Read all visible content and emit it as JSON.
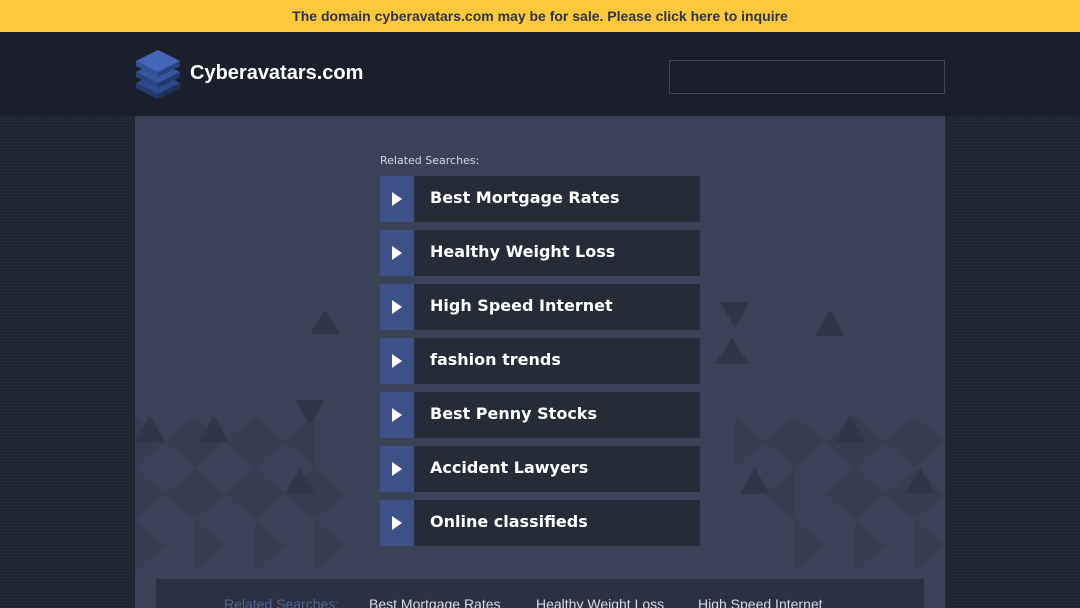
{
  "banner": {
    "text": "The domain cyberavatars.com may be for sale. Please click here to inquire"
  },
  "header": {
    "site_name": "Cyberavatars.com",
    "logo_icon": "stacked-layers-icon",
    "search_value": ""
  },
  "main": {
    "related_label": "Related Searches:",
    "arrow_icon": "play-arrow-icon",
    "links": [
      {
        "label": "Best Mortgage Rates"
      },
      {
        "label": "Healthy Weight Loss"
      },
      {
        "label": "High Speed Internet"
      },
      {
        "label": "fashion trends"
      },
      {
        "label": "Best Penny Stocks"
      },
      {
        "label": "Accident Lawyers"
      },
      {
        "label": "Online classifieds"
      }
    ]
  },
  "footer": {
    "label": "Related Searches:",
    "links": [
      "Best Mortgage Rates",
      "Healthy Weight Loss",
      "High Speed Internet"
    ]
  },
  "colors": {
    "banner_bg": "#fdc93a",
    "banner_text": "#2b3450",
    "header_bg": "#1b1f2b",
    "panel_bg": "#3a4257",
    "arrow_bg": "#3d5088",
    "link_bg": "#262b38"
  }
}
